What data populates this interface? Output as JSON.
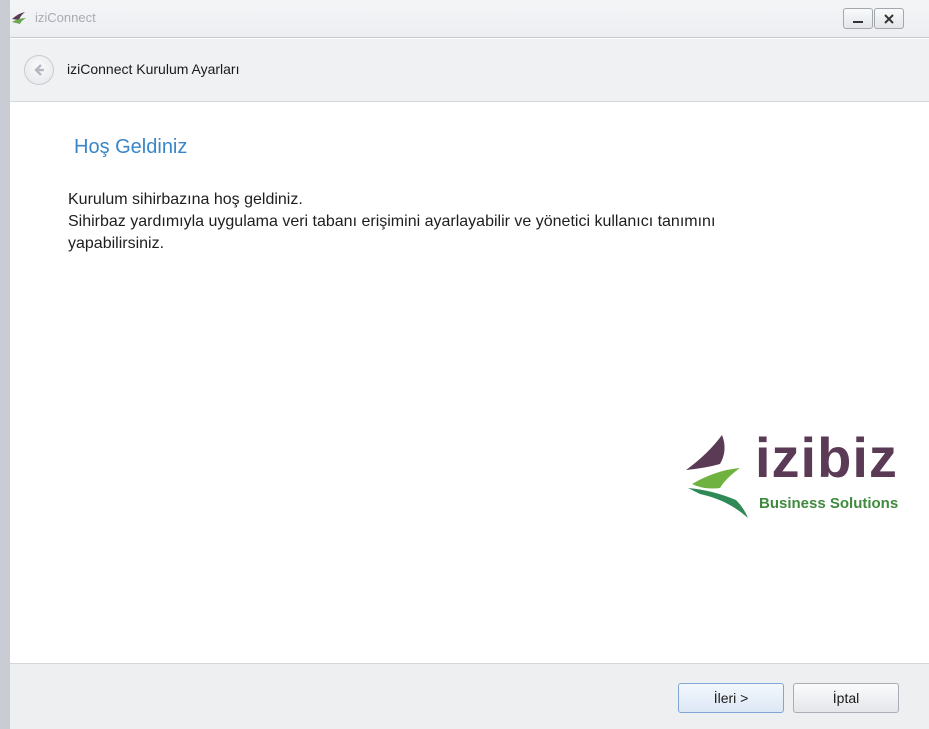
{
  "window": {
    "title": "iziConnect"
  },
  "header": {
    "title": "iziConnect Kurulum Ayarları"
  },
  "content": {
    "welcome_title": "Hoş Geldiniz",
    "line1": "Kurulum sihirbazına hoş geldiniz.",
    "line2": "Sihirbaz yardımıyla uygulama veri tabanı erişimini ayarlayabilir ve yönetici kullanıcı tanımını",
    "line3": "yapabilirsiniz."
  },
  "logo": {
    "word": "izibiz",
    "tagline": "Business Solutions"
  },
  "footer": {
    "next_label": "İleri >",
    "cancel_label": "İptal"
  },
  "colors": {
    "accent_blue": "#3a86c8",
    "logo_purple": "#5a3a55",
    "logo_green": "#3f8a3f"
  }
}
